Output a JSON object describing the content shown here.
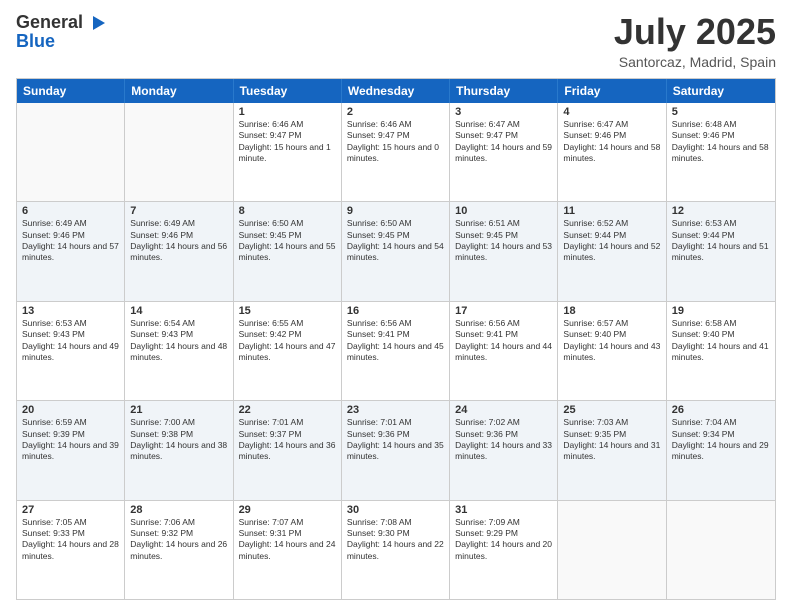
{
  "header": {
    "logo_general": "General",
    "logo_blue": "Blue",
    "month_title": "July 2025",
    "location": "Santorcaz, Madrid, Spain"
  },
  "days_of_week": [
    "Sunday",
    "Monday",
    "Tuesday",
    "Wednesday",
    "Thursday",
    "Friday",
    "Saturday"
  ],
  "weeks": [
    [
      {
        "day": "",
        "sunrise": "",
        "sunset": "",
        "daylight": "",
        "empty": true
      },
      {
        "day": "",
        "sunrise": "",
        "sunset": "",
        "daylight": "",
        "empty": true
      },
      {
        "day": "1",
        "sunrise": "Sunrise: 6:46 AM",
        "sunset": "Sunset: 9:47 PM",
        "daylight": "Daylight: 15 hours and 1 minute.",
        "empty": false
      },
      {
        "day": "2",
        "sunrise": "Sunrise: 6:46 AM",
        "sunset": "Sunset: 9:47 PM",
        "daylight": "Daylight: 15 hours and 0 minutes.",
        "empty": false
      },
      {
        "day": "3",
        "sunrise": "Sunrise: 6:47 AM",
        "sunset": "Sunset: 9:47 PM",
        "daylight": "Daylight: 14 hours and 59 minutes.",
        "empty": false
      },
      {
        "day": "4",
        "sunrise": "Sunrise: 6:47 AM",
        "sunset": "Sunset: 9:46 PM",
        "daylight": "Daylight: 14 hours and 58 minutes.",
        "empty": false
      },
      {
        "day": "5",
        "sunrise": "Sunrise: 6:48 AM",
        "sunset": "Sunset: 9:46 PM",
        "daylight": "Daylight: 14 hours and 58 minutes.",
        "empty": false
      }
    ],
    [
      {
        "day": "6",
        "sunrise": "Sunrise: 6:49 AM",
        "sunset": "Sunset: 9:46 PM",
        "daylight": "Daylight: 14 hours and 57 minutes.",
        "empty": false
      },
      {
        "day": "7",
        "sunrise": "Sunrise: 6:49 AM",
        "sunset": "Sunset: 9:46 PM",
        "daylight": "Daylight: 14 hours and 56 minutes.",
        "empty": false
      },
      {
        "day": "8",
        "sunrise": "Sunrise: 6:50 AM",
        "sunset": "Sunset: 9:45 PM",
        "daylight": "Daylight: 14 hours and 55 minutes.",
        "empty": false
      },
      {
        "day": "9",
        "sunrise": "Sunrise: 6:50 AM",
        "sunset": "Sunset: 9:45 PM",
        "daylight": "Daylight: 14 hours and 54 minutes.",
        "empty": false
      },
      {
        "day": "10",
        "sunrise": "Sunrise: 6:51 AM",
        "sunset": "Sunset: 9:45 PM",
        "daylight": "Daylight: 14 hours and 53 minutes.",
        "empty": false
      },
      {
        "day": "11",
        "sunrise": "Sunrise: 6:52 AM",
        "sunset": "Sunset: 9:44 PM",
        "daylight": "Daylight: 14 hours and 52 minutes.",
        "empty": false
      },
      {
        "day": "12",
        "sunrise": "Sunrise: 6:53 AM",
        "sunset": "Sunset: 9:44 PM",
        "daylight": "Daylight: 14 hours and 51 minutes.",
        "empty": false
      }
    ],
    [
      {
        "day": "13",
        "sunrise": "Sunrise: 6:53 AM",
        "sunset": "Sunset: 9:43 PM",
        "daylight": "Daylight: 14 hours and 49 minutes.",
        "empty": false
      },
      {
        "day": "14",
        "sunrise": "Sunrise: 6:54 AM",
        "sunset": "Sunset: 9:43 PM",
        "daylight": "Daylight: 14 hours and 48 minutes.",
        "empty": false
      },
      {
        "day": "15",
        "sunrise": "Sunrise: 6:55 AM",
        "sunset": "Sunset: 9:42 PM",
        "daylight": "Daylight: 14 hours and 47 minutes.",
        "empty": false
      },
      {
        "day": "16",
        "sunrise": "Sunrise: 6:56 AM",
        "sunset": "Sunset: 9:41 PM",
        "daylight": "Daylight: 14 hours and 45 minutes.",
        "empty": false
      },
      {
        "day": "17",
        "sunrise": "Sunrise: 6:56 AM",
        "sunset": "Sunset: 9:41 PM",
        "daylight": "Daylight: 14 hours and 44 minutes.",
        "empty": false
      },
      {
        "day": "18",
        "sunrise": "Sunrise: 6:57 AM",
        "sunset": "Sunset: 9:40 PM",
        "daylight": "Daylight: 14 hours and 43 minutes.",
        "empty": false
      },
      {
        "day": "19",
        "sunrise": "Sunrise: 6:58 AM",
        "sunset": "Sunset: 9:40 PM",
        "daylight": "Daylight: 14 hours and 41 minutes.",
        "empty": false
      }
    ],
    [
      {
        "day": "20",
        "sunrise": "Sunrise: 6:59 AM",
        "sunset": "Sunset: 9:39 PM",
        "daylight": "Daylight: 14 hours and 39 minutes.",
        "empty": false
      },
      {
        "day": "21",
        "sunrise": "Sunrise: 7:00 AM",
        "sunset": "Sunset: 9:38 PM",
        "daylight": "Daylight: 14 hours and 38 minutes.",
        "empty": false
      },
      {
        "day": "22",
        "sunrise": "Sunrise: 7:01 AM",
        "sunset": "Sunset: 9:37 PM",
        "daylight": "Daylight: 14 hours and 36 minutes.",
        "empty": false
      },
      {
        "day": "23",
        "sunrise": "Sunrise: 7:01 AM",
        "sunset": "Sunset: 9:36 PM",
        "daylight": "Daylight: 14 hours and 35 minutes.",
        "empty": false
      },
      {
        "day": "24",
        "sunrise": "Sunrise: 7:02 AM",
        "sunset": "Sunset: 9:36 PM",
        "daylight": "Daylight: 14 hours and 33 minutes.",
        "empty": false
      },
      {
        "day": "25",
        "sunrise": "Sunrise: 7:03 AM",
        "sunset": "Sunset: 9:35 PM",
        "daylight": "Daylight: 14 hours and 31 minutes.",
        "empty": false
      },
      {
        "day": "26",
        "sunrise": "Sunrise: 7:04 AM",
        "sunset": "Sunset: 9:34 PM",
        "daylight": "Daylight: 14 hours and 29 minutes.",
        "empty": false
      }
    ],
    [
      {
        "day": "27",
        "sunrise": "Sunrise: 7:05 AM",
        "sunset": "Sunset: 9:33 PM",
        "daylight": "Daylight: 14 hours and 28 minutes.",
        "empty": false
      },
      {
        "day": "28",
        "sunrise": "Sunrise: 7:06 AM",
        "sunset": "Sunset: 9:32 PM",
        "daylight": "Daylight: 14 hours and 26 minutes.",
        "empty": false
      },
      {
        "day": "29",
        "sunrise": "Sunrise: 7:07 AM",
        "sunset": "Sunset: 9:31 PM",
        "daylight": "Daylight: 14 hours and 24 minutes.",
        "empty": false
      },
      {
        "day": "30",
        "sunrise": "Sunrise: 7:08 AM",
        "sunset": "Sunset: 9:30 PM",
        "daylight": "Daylight: 14 hours and 22 minutes.",
        "empty": false
      },
      {
        "day": "31",
        "sunrise": "Sunrise: 7:09 AM",
        "sunset": "Sunset: 9:29 PM",
        "daylight": "Daylight: 14 hours and 20 minutes.",
        "empty": false
      },
      {
        "day": "",
        "sunrise": "",
        "sunset": "",
        "daylight": "",
        "empty": true
      },
      {
        "day": "",
        "sunrise": "",
        "sunset": "",
        "daylight": "",
        "empty": true
      }
    ]
  ]
}
